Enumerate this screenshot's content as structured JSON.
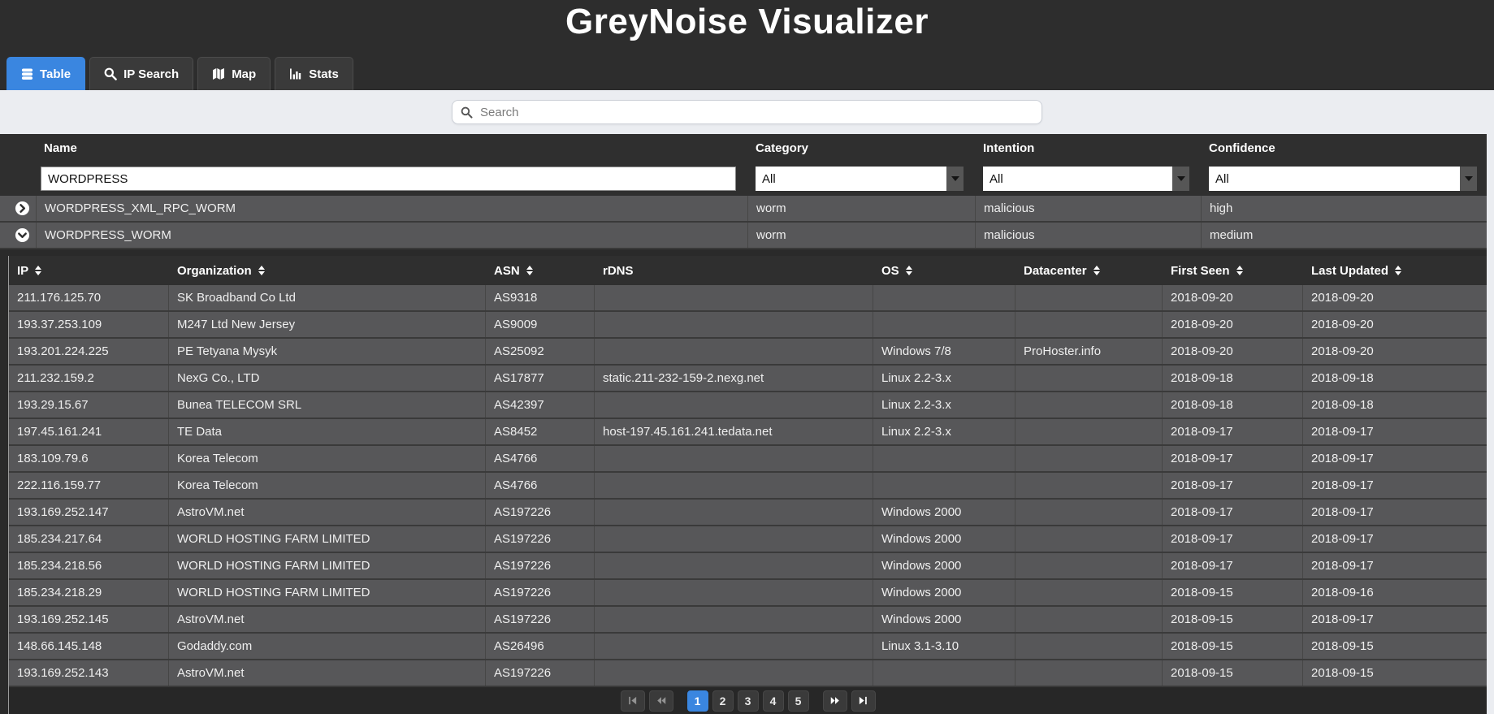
{
  "app": {
    "title": "GreyNoise Visualizer"
  },
  "ui_colors": {
    "accent_blue": "#3a86e0",
    "panel_dark": "#2d2d2d",
    "row_gray": "#575759"
  },
  "tabs": [
    {
      "label": "Table",
      "icon": "database-icon",
      "active": true
    },
    {
      "label": "IP Search",
      "icon": "search-icon",
      "active": false
    },
    {
      "label": "Map",
      "icon": "map-icon",
      "active": false
    },
    {
      "label": "Stats",
      "icon": "bar-chart-icon",
      "active": false
    }
  ],
  "search": {
    "placeholder": "Search"
  },
  "results_table": {
    "columns": {
      "name": "Name",
      "category": "Category",
      "intention": "Intention",
      "confidence": "Confidence"
    },
    "filters": {
      "name_value": "WORDPRESS",
      "category_value": "All",
      "intention_value": "All",
      "confidence_value": "All"
    },
    "rows": [
      {
        "name": "WORDPRESS_XML_RPC_WORM",
        "category": "worm",
        "intention": "malicious",
        "confidence": "high",
        "expanded": false
      },
      {
        "name": "WORDPRESS_WORM",
        "category": "worm",
        "intention": "malicious",
        "confidence": "medium",
        "expanded": true
      }
    ]
  },
  "detail_table": {
    "columns": [
      {
        "key": "ip",
        "label": "IP",
        "sortable": true
      },
      {
        "key": "org",
        "label": "Organization",
        "sortable": true
      },
      {
        "key": "asn",
        "label": "ASN",
        "sortable": true
      },
      {
        "key": "rdns",
        "label": "rDNS",
        "sortable": false
      },
      {
        "key": "os",
        "label": "OS",
        "sortable": true
      },
      {
        "key": "datacenter",
        "label": "Datacenter",
        "sortable": true
      },
      {
        "key": "first_seen",
        "label": "First Seen",
        "sortable": true
      },
      {
        "key": "last_updated",
        "label": "Last Updated",
        "sortable": true
      }
    ],
    "rows": [
      {
        "ip": "211.176.125.70",
        "org": "SK Broadband Co Ltd",
        "asn": "AS9318",
        "rdns": "",
        "os": "",
        "datacenter": "",
        "first_seen": "2018-09-20",
        "last_updated": "2018-09-20"
      },
      {
        "ip": "193.37.253.109",
        "org": "M247 Ltd New Jersey",
        "asn": "AS9009",
        "rdns": "",
        "os": "",
        "datacenter": "",
        "first_seen": "2018-09-20",
        "last_updated": "2018-09-20"
      },
      {
        "ip": "193.201.224.225",
        "org": "PE Tetyana Mysyk",
        "asn": "AS25092",
        "rdns": "",
        "os": "Windows 7/8",
        "datacenter": "ProHoster.info",
        "first_seen": "2018-09-20",
        "last_updated": "2018-09-20"
      },
      {
        "ip": "211.232.159.2",
        "org": "NexG Co., LTD",
        "asn": "AS17877",
        "rdns": "static.211-232-159-2.nexg.net",
        "os": "Linux 2.2-3.x",
        "datacenter": "",
        "first_seen": "2018-09-18",
        "last_updated": "2018-09-18"
      },
      {
        "ip": "193.29.15.67",
        "org": "Bunea TELECOM SRL",
        "asn": "AS42397",
        "rdns": "",
        "os": "Linux 2.2-3.x",
        "datacenter": "",
        "first_seen": "2018-09-18",
        "last_updated": "2018-09-18"
      },
      {
        "ip": "197.45.161.241",
        "org": "TE Data",
        "asn": "AS8452",
        "rdns": "host-197.45.161.241.tedata.net",
        "os": "Linux 2.2-3.x",
        "datacenter": "",
        "first_seen": "2018-09-17",
        "last_updated": "2018-09-17"
      },
      {
        "ip": "183.109.79.6",
        "org": "Korea Telecom",
        "asn": "AS4766",
        "rdns": "",
        "os": "",
        "datacenter": "",
        "first_seen": "2018-09-17",
        "last_updated": "2018-09-17"
      },
      {
        "ip": "222.116.159.77",
        "org": "Korea Telecom",
        "asn": "AS4766",
        "rdns": "",
        "os": "",
        "datacenter": "",
        "first_seen": "2018-09-17",
        "last_updated": "2018-09-17"
      },
      {
        "ip": "193.169.252.147",
        "org": "AstroVM.net",
        "asn": "AS197226",
        "rdns": "",
        "os": "Windows 2000",
        "datacenter": "",
        "first_seen": "2018-09-17",
        "last_updated": "2018-09-17"
      },
      {
        "ip": "185.234.217.64",
        "org": "WORLD HOSTING FARM LIMITED",
        "asn": "AS197226",
        "rdns": "",
        "os": "Windows 2000",
        "datacenter": "",
        "first_seen": "2018-09-17",
        "last_updated": "2018-09-17"
      },
      {
        "ip": "185.234.218.56",
        "org": "WORLD HOSTING FARM LIMITED",
        "asn": "AS197226",
        "rdns": "",
        "os": "Windows 2000",
        "datacenter": "",
        "first_seen": "2018-09-17",
        "last_updated": "2018-09-17"
      },
      {
        "ip": "185.234.218.29",
        "org": "WORLD HOSTING FARM LIMITED",
        "asn": "AS197226",
        "rdns": "",
        "os": "Windows 2000",
        "datacenter": "",
        "first_seen": "2018-09-15",
        "last_updated": "2018-09-16"
      },
      {
        "ip": "193.169.252.145",
        "org": "AstroVM.net",
        "asn": "AS197226",
        "rdns": "",
        "os": "Windows 2000",
        "datacenter": "",
        "first_seen": "2018-09-15",
        "last_updated": "2018-09-17"
      },
      {
        "ip": "148.66.145.148",
        "org": "Godaddy.com",
        "asn": "AS26496",
        "rdns": "",
        "os": "Linux 3.1-3.10",
        "datacenter": "",
        "first_seen": "2018-09-15",
        "last_updated": "2018-09-15"
      },
      {
        "ip": "193.169.252.143",
        "org": "AstroVM.net",
        "asn": "AS197226",
        "rdns": "",
        "os": "",
        "datacenter": "",
        "first_seen": "2018-09-15",
        "last_updated": "2018-09-15"
      }
    ]
  },
  "pagination": {
    "pages": [
      "1",
      "2",
      "3",
      "4",
      "5"
    ],
    "active_page": "1"
  }
}
